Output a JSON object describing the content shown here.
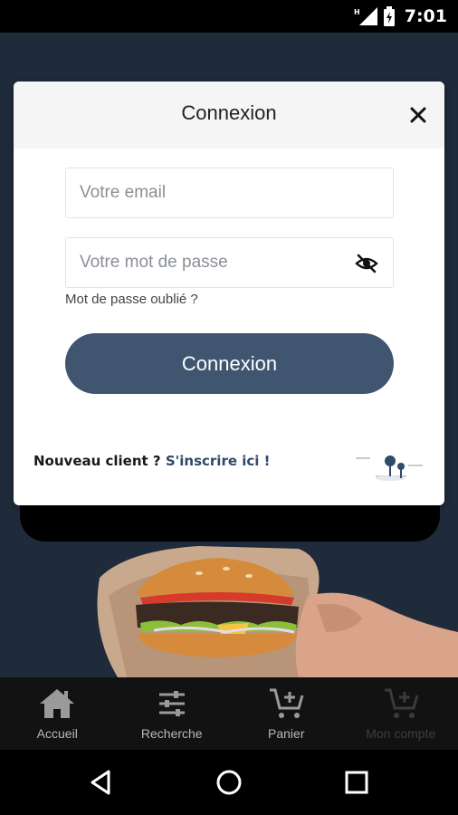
{
  "status_bar": {
    "time": "7:01"
  },
  "modal": {
    "title": "Connexion",
    "email_placeholder": "Votre email",
    "password_placeholder": "Votre mot de passe",
    "forgot_password": "Mot de passe oublié ?",
    "login_button": "Connexion",
    "new_client_text": "Nouveau client ?",
    "signup_link": "S'inscrire ici !"
  },
  "bottom_nav": {
    "items": [
      {
        "label": "Accueil",
        "icon": "home-icon"
      },
      {
        "label": "Recherche",
        "icon": "filter-icon"
      },
      {
        "label": "Panier",
        "icon": "cart-add-icon"
      },
      {
        "label": "Mon compte",
        "icon": "cart-add-icon",
        "disabled": true
      }
    ]
  },
  "colors": {
    "primary": "#3f5570",
    "background": "#1f2b3a",
    "link": "#2f4a6a",
    "nav_bg": "#121212"
  }
}
